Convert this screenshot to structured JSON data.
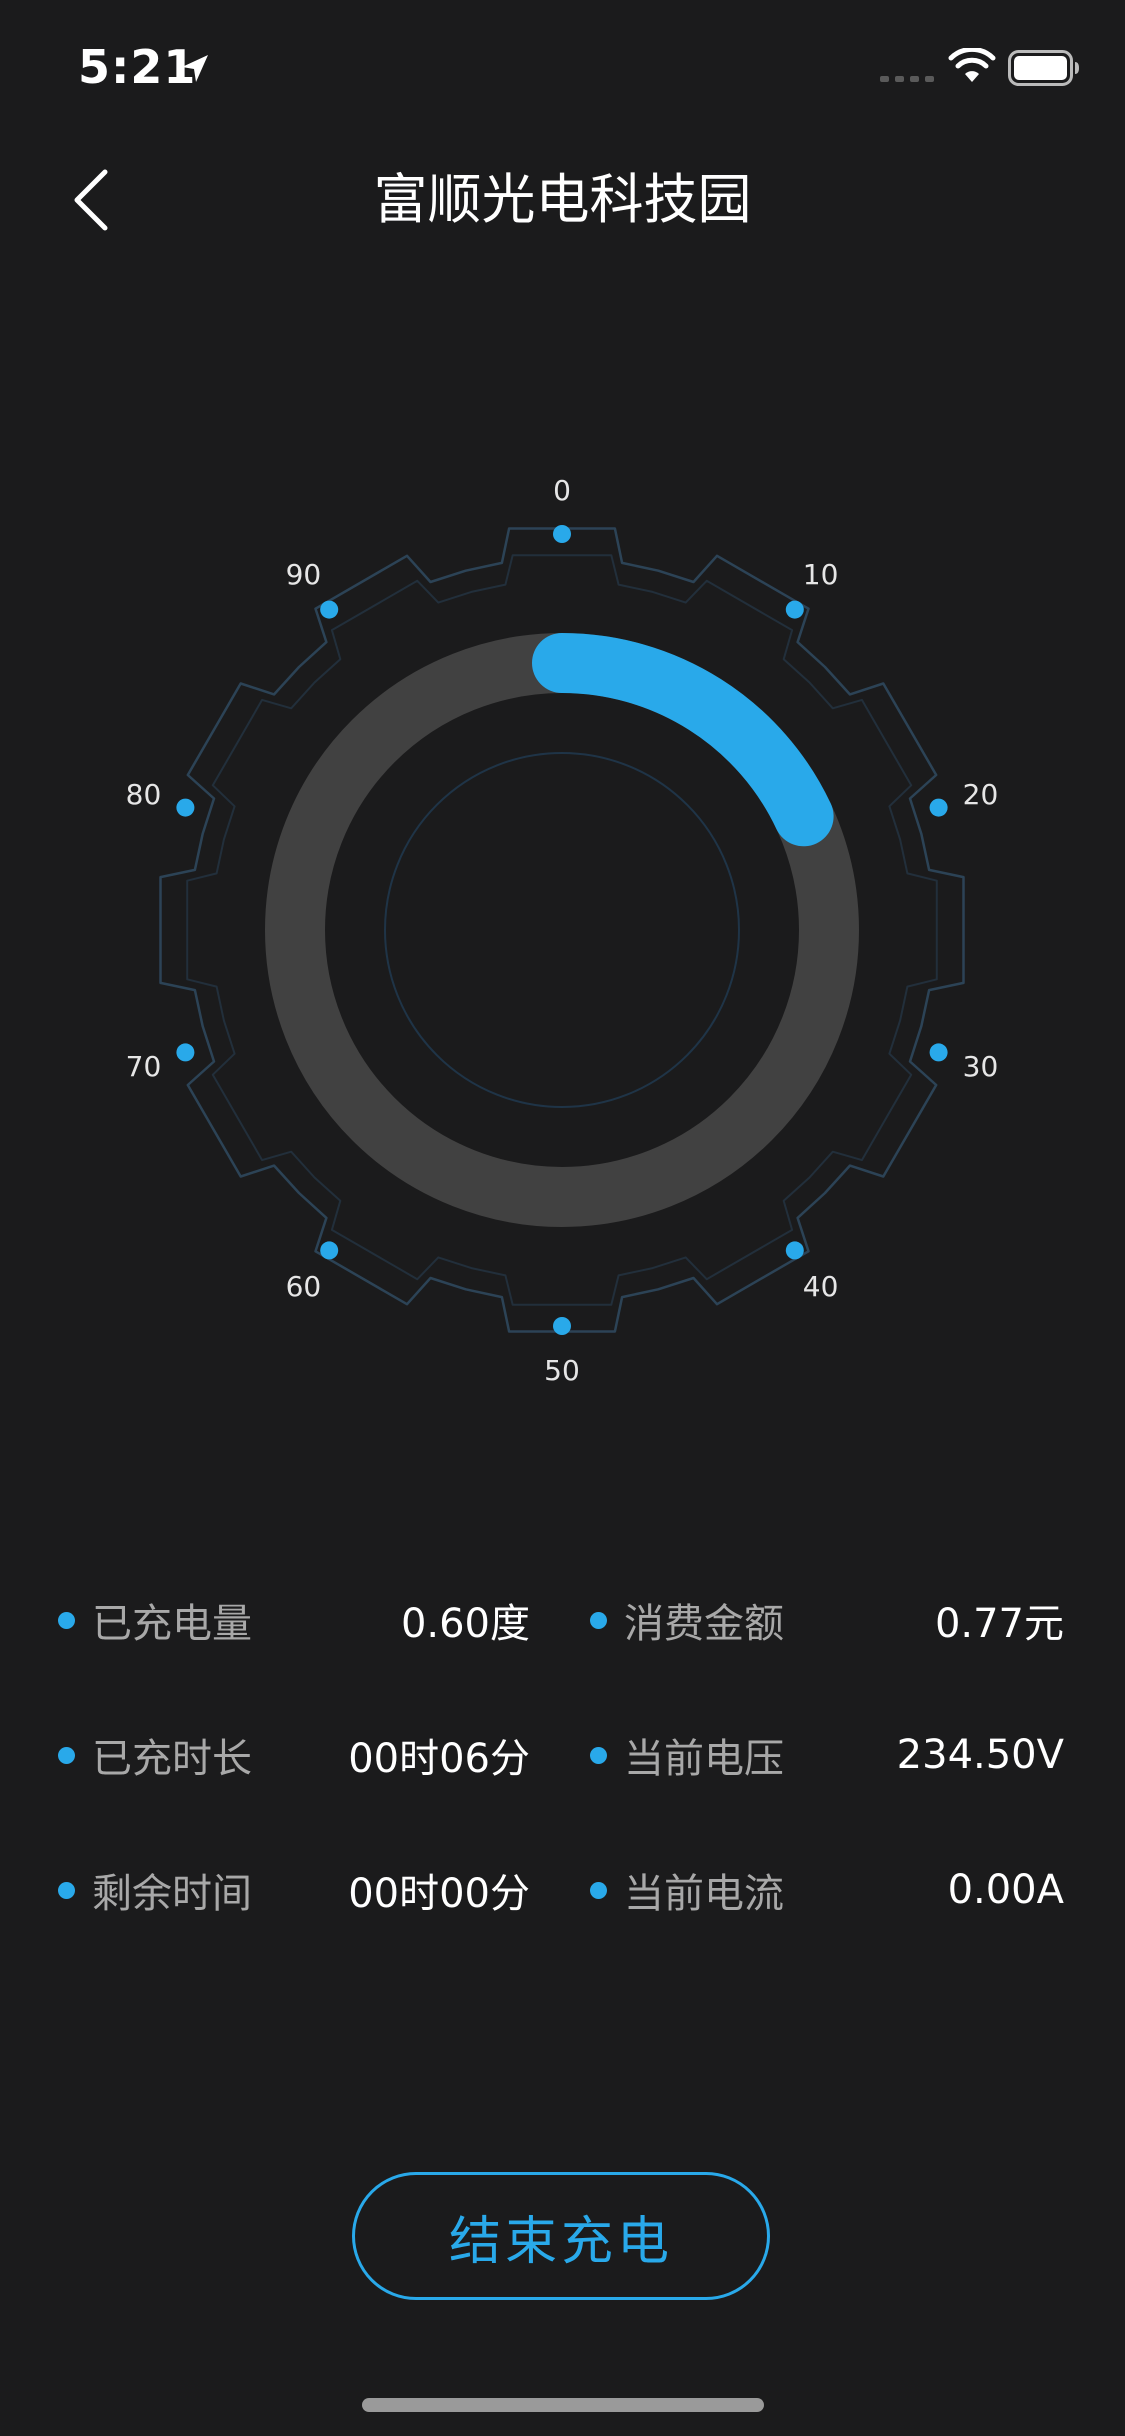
{
  "status_bar": {
    "time": "5:21"
  },
  "nav": {
    "title": "富顺光电科技园"
  },
  "gauge": {
    "scale_labels": [
      "0",
      "10",
      "20",
      "30",
      "40",
      "50",
      "60",
      "70",
      "80",
      "90"
    ],
    "progress_start_value": 0,
    "progress_end_value": 18,
    "progress_color": "#29a9ea",
    "track_color": "#414141",
    "tick_dot_color": "#29a9ea"
  },
  "stats": {
    "rows": [
      [
        {
          "label": "已充电量",
          "value": "0.60度"
        },
        {
          "label": "消费金额",
          "value": "0.77元"
        }
      ],
      [
        {
          "label": "已充时长",
          "value": "00时06分"
        },
        {
          "label": "当前电压",
          "value": "234.50V"
        }
      ],
      [
        {
          "label": "剩余时间",
          "value": "00时00分"
        },
        {
          "label": "当前电流",
          "value": "0.00A"
        }
      ]
    ]
  },
  "actions": {
    "end_label": "结束充电"
  },
  "colors": {
    "background": "#1b1b1c",
    "accent": "#29a9ea",
    "label_gray": "#a8a8a8"
  }
}
